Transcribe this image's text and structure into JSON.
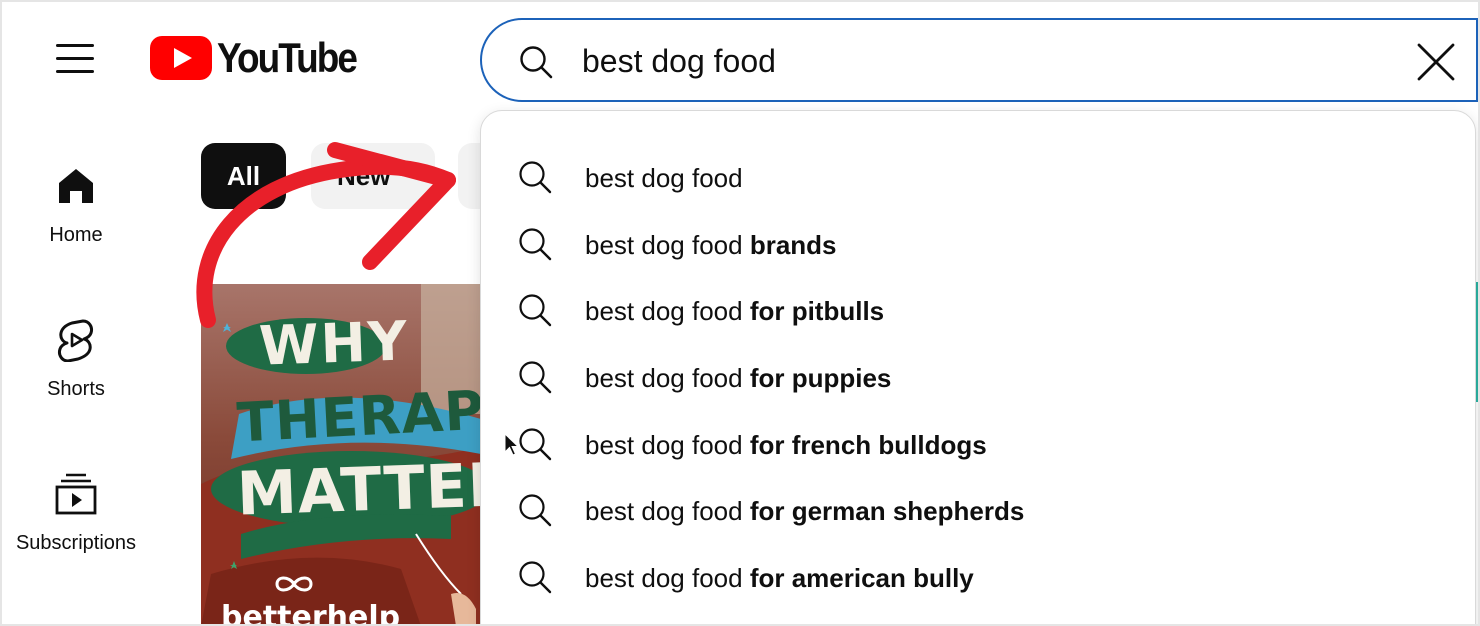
{
  "header": {
    "logo_text": "YouTube",
    "search_value": "best dog food"
  },
  "sidebar": {
    "items": [
      {
        "label": "Home",
        "icon": "home-icon"
      },
      {
        "label": "Shorts",
        "icon": "shorts-icon"
      },
      {
        "label": "Subscriptions",
        "icon": "subscriptions-icon"
      }
    ]
  },
  "chips": [
    {
      "label": "All",
      "selected": true
    },
    {
      "label": "New",
      "selected": false
    }
  ],
  "suggestions": [
    {
      "prefix": "best dog food",
      "suffix": ""
    },
    {
      "prefix": "best dog food",
      "suffix": "brands"
    },
    {
      "prefix": "best dog food",
      "suffix": "for pitbulls"
    },
    {
      "prefix": "best dog food",
      "suffix": "for puppies"
    },
    {
      "prefix": "best dog food",
      "suffix": "for french bulldogs"
    },
    {
      "prefix": "best dog food",
      "suffix": "for german shepherds"
    },
    {
      "prefix": "best dog food",
      "suffix": "for american bully"
    }
  ],
  "thumbnail": {
    "lines": [
      "WHY",
      "THERAPY",
      "MATTERS"
    ],
    "brand": "betterhelp"
  },
  "colors": {
    "brand_red": "#ff0000",
    "search_focus": "#1c62b9",
    "annotation_red": "#e8202a"
  }
}
